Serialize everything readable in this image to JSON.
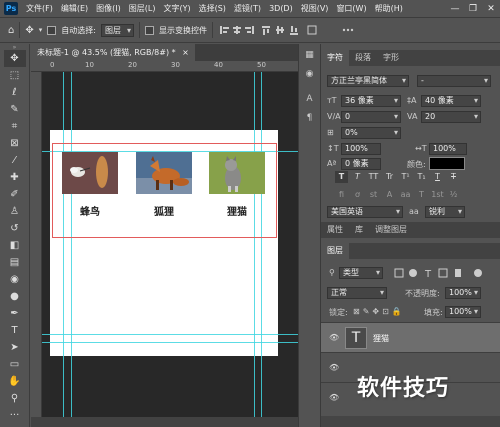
{
  "menubar": {
    "logo": "Ps",
    "items": [
      "文件(F)",
      "编辑(E)",
      "图像(I)",
      "图层(L)",
      "文字(Y)",
      "选择(S)",
      "滤镜(T)",
      "3D(D)",
      "视图(V)",
      "窗口(W)",
      "帮助(H)"
    ],
    "minimize": "—",
    "restore": "❐",
    "close": "✕"
  },
  "optbar": {
    "auto_select_label": "自动选择:",
    "auto_select_value": "图层",
    "show_transform_label": "显示变换控件"
  },
  "document": {
    "tab_title": "未标题-1 @ 43.5% (狸猫, RGB/8#) *",
    "tab_close": "×",
    "ruler_top": [
      "0",
      "10",
      "20",
      "30",
      "40",
      "50"
    ],
    "captions": [
      "蜂鸟",
      "狐狸",
      "狸猫"
    ]
  },
  "character_panel": {
    "tabs": [
      "字符",
      "段落",
      "字形"
    ],
    "font_family": "方正兰亭黑简体",
    "font_style": "-",
    "font_size": "36 像素",
    "leading": "40 像素",
    "kerning": "0",
    "tracking": "20",
    "tsume": "0%",
    "vertical_scale": "100%",
    "horizontal_scale": "100%",
    "baseline_shift": "0 像素",
    "color_label": "颜色:",
    "glyph_buttons": [
      "T",
      "T",
      "TT",
      "Tr",
      "T¹",
      "T₁",
      "T",
      "T"
    ],
    "opentype_buttons": [
      "fi",
      "ơ",
      "st",
      "A",
      "aa",
      "T",
      "1st",
      "½"
    ],
    "language": "美国英语",
    "antialias_icon": "aa",
    "antialias": "锐利",
    "color_value": "#000000"
  },
  "properties_tabs": [
    "属性",
    "库",
    "调整图层"
  ],
  "layers_panel": {
    "tab": "图层",
    "filter": "类型",
    "blend_mode": "正常",
    "opacity_label": "不透明度:",
    "opacity": "100%",
    "lock_label": "锁定:",
    "fill_label": "填充:",
    "fill": "100%",
    "layers": [
      {
        "name": "狸猫",
        "type": "text"
      },
      {
        "name": "",
        "type": "image"
      },
      {
        "name": "",
        "type": "image"
      }
    ]
  },
  "watermark": "软件技巧"
}
